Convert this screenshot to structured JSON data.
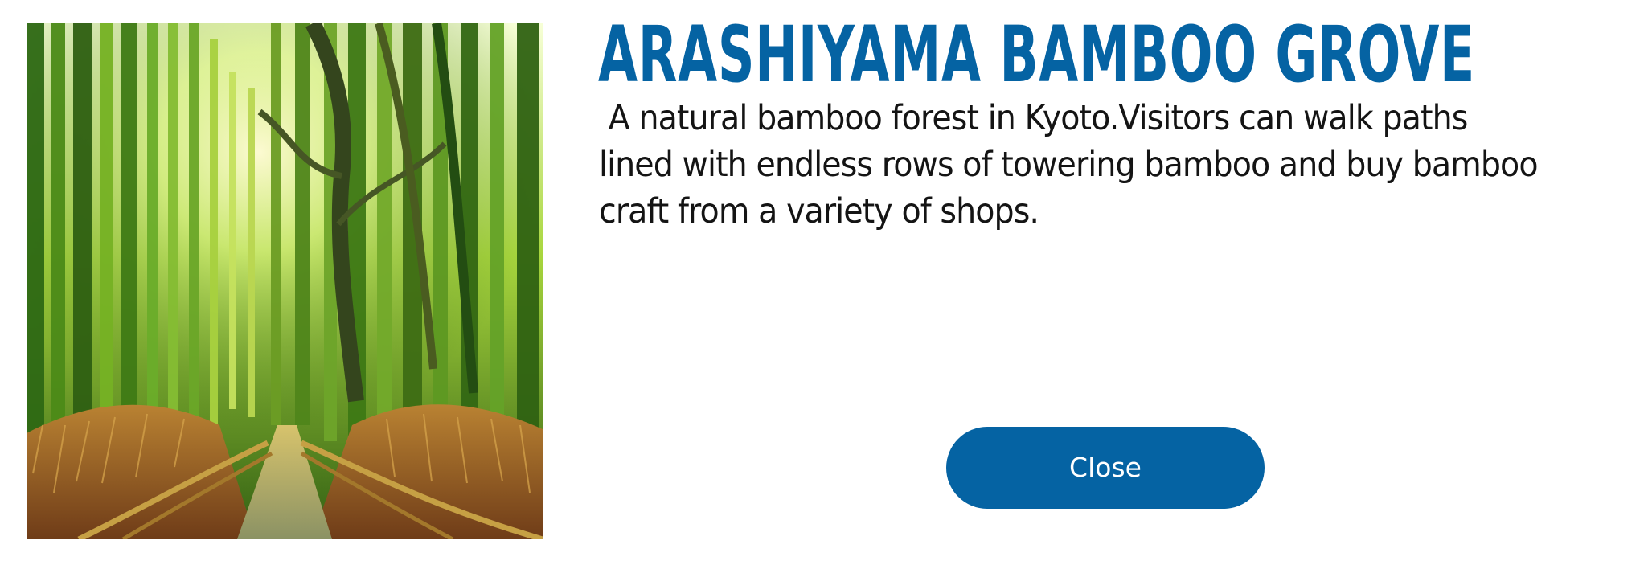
{
  "dialog": {
    "title": "ARASHIYAMA BAMBOO GROVE",
    "description": " A natural bamboo forest in Kyoto.Visitors can walk paths lined with endless rows of towering bamboo and buy bamboo craft from a variety of shops.",
    "close_label": "Close",
    "image": {
      "subject": "bamboo grove path photo"
    }
  },
  "colors": {
    "title": "#0563a3",
    "button_background": "#0563a3",
    "button_text": "#ffffff",
    "description": "#141414"
  }
}
